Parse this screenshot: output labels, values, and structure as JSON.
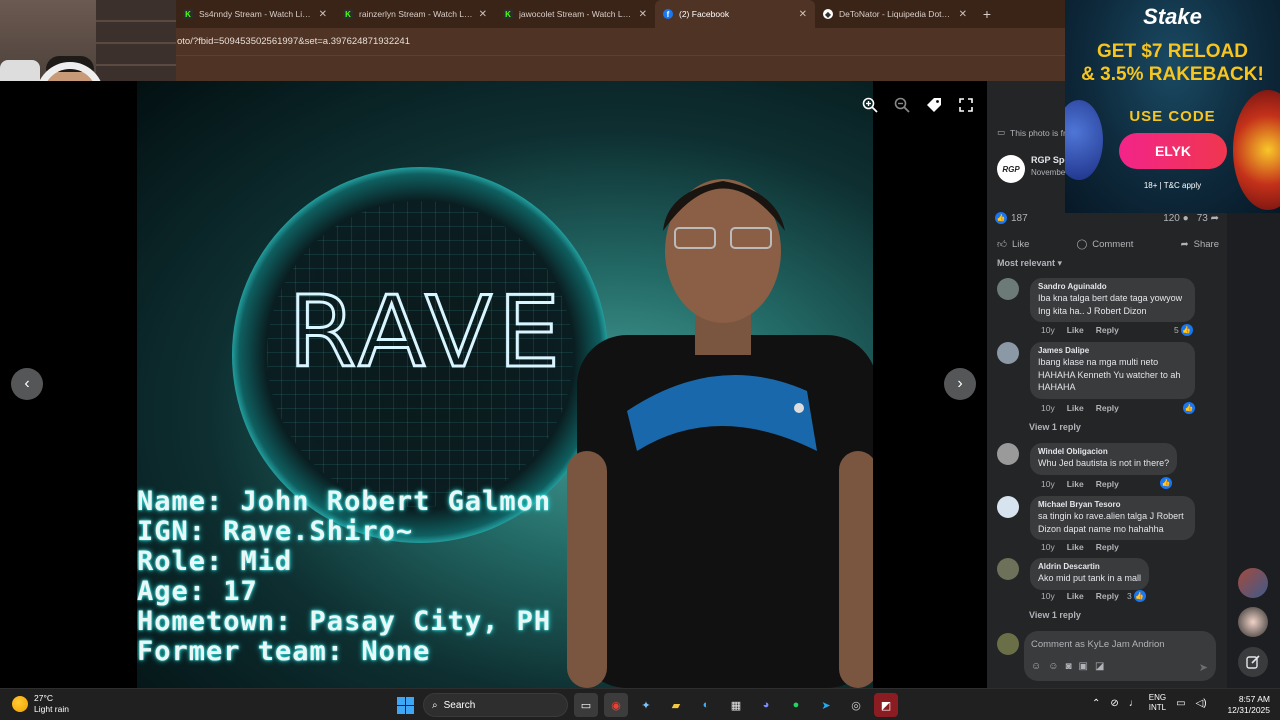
{
  "browser": {
    "tabs": [
      {
        "title": "Ss4nndy Stream - Watch Live o",
        "favicon": "kick-icon",
        "active": false
      },
      {
        "title": "rainzerlyn Stream - Watch Live",
        "favicon": "kick-icon",
        "active": false
      },
      {
        "title": "jawocolet Stream - Watch Live",
        "favicon": "kick-icon",
        "active": false
      },
      {
        "title": "(2) Facebook",
        "favicon": "facebook-icon",
        "active": true
      },
      {
        "title": "DeToNator - Liquipedia Dota 2",
        "favicon": "liquipedia-icon",
        "active": false
      }
    ],
    "new_tab": "+",
    "url": "oto/?fbid=509453502561997&set=a.397624871932241"
  },
  "photo": {
    "logo_text": "RAVE",
    "caption_lines": [
      "Name: John Robert Galmon",
      "IGN: Rave.Shiro~",
      "Role: Mid",
      "Age: 17",
      "Hometown: Pasay City, PH",
      "Former team: None"
    ],
    "tools": [
      "zoom-in-icon",
      "zoom-out-icon",
      "tag-icon",
      "fullscreen-icon"
    ],
    "prev_icon": "‹",
    "next_icon": "›"
  },
  "post": {
    "notice": "This photo is fr",
    "page_avatar": "RGP",
    "page_name": "RGP Spo",
    "date": "Novembe",
    "likes": "187",
    "comments_count": "120",
    "shares_count": "73",
    "actions": {
      "like": "Like",
      "comment": "Comment",
      "share": "Share"
    },
    "sort_label": "Most relevant"
  },
  "comments": [
    {
      "name": "Sandro Aguinaldo",
      "text": "Iba kna talga bert date taga yowyow Ing kita ha.. J Robert Dizon",
      "time": "10y",
      "like": "Like",
      "reply": "Reply",
      "reactions": "5"
    },
    {
      "name": "James Dalipe",
      "text": "Ibang klase na mga multi neto HAHAHA Kenneth Yu watcher to ah HAHAHA",
      "time": "10y",
      "like": "Like",
      "reply": "Reply",
      "reactions": "",
      "view_replies": "View 1 reply"
    },
    {
      "name": "Windel Obligacion",
      "text": "Whu Jed bautista is not in there?",
      "time": "10y",
      "like": "Like",
      "reply": "Reply",
      "reactions": ""
    },
    {
      "name": "Michael Bryan Tesoro",
      "text": "sa tingin ko rave.alien talga J Robert Dizon dapat name mo hahahha",
      "time": "10y",
      "like": "Like",
      "reply": "Reply",
      "reactions": ""
    },
    {
      "name": "Aldrin Descartin",
      "text": "Ako mid put tank in a mall",
      "time": "10y",
      "like": "Like",
      "reply": "Reply",
      "reactions": "3",
      "view_replies": "View 1 reply"
    }
  ],
  "composer": {
    "placeholder": "Comment as KyLe Jam Andrion"
  },
  "ad": {
    "brand": "Stake",
    "headline_1": "GET $7 RELOAD",
    "headline_2": "& 3.5% RAKEBACK!",
    "use_code": "USE CODE",
    "code": "ELYK",
    "terms": "18+ | T&C apply"
  },
  "taskbar": {
    "temperature": "27°C",
    "weather": "Light rain",
    "search": "Search",
    "lang_1": "ENG",
    "lang_2": "INTL",
    "time": "8:57 AM",
    "date": "12/31/2025"
  },
  "colors": {
    "fb_blue": "#1877f2",
    "panel_bg": "#242526",
    "bubble_bg": "#3a3b3c",
    "tab_bg": "#3a2418",
    "caption_glow": "#2ad8d6"
  }
}
